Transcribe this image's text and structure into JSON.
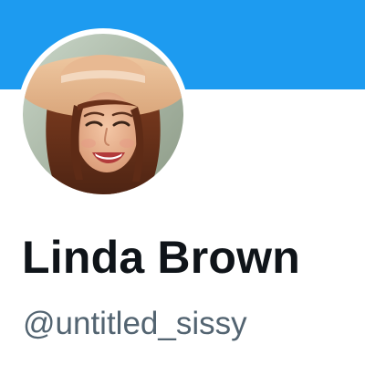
{
  "profile": {
    "display_name": "Linda Brown",
    "handle": "@untitled_sissy",
    "avatar": "profile-photo-woman-straw-hat"
  },
  "colors": {
    "banner": "#1d9bf0",
    "name_text": "#0f1419",
    "handle_text": "#536471",
    "background": "#ffffff"
  }
}
